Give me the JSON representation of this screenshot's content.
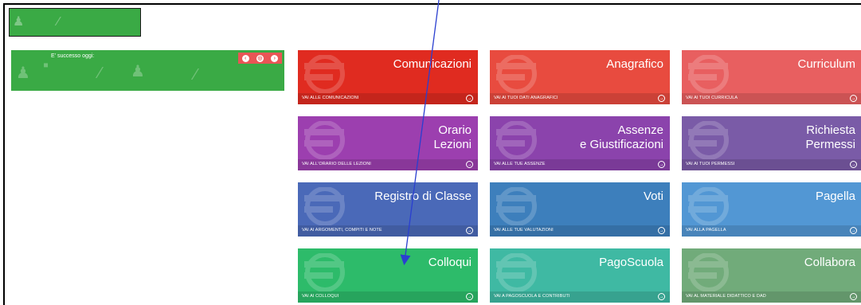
{
  "today_widget": {
    "title": "E' successo oggi:",
    "nav_icons": [
      "prev-icon",
      "settings-icon",
      "next-icon"
    ]
  },
  "tiles": [
    {
      "name": "comunicazioni",
      "title": "Comunicazioni",
      "link": "VAI ALLE COMUNICAZIONI",
      "color": "#e02b20",
      "icon": "megaphone-icon"
    },
    {
      "name": "anagrafico",
      "title": "Anagrafico",
      "link": "VAI AI TUOI DATI ANAGRAFICI",
      "color": "#e84b3f",
      "icon": "person-icon"
    },
    {
      "name": "curriculum",
      "title": "Curriculum",
      "link": "VAI AI TUOI CURRICULA",
      "color": "#e85f60",
      "icon": "list-icon"
    },
    {
      "name": "orario-lezioni",
      "title": "Orario\nLezioni",
      "link": "VAI ALL'ORARIO DELLE LEZIONI",
      "color": "#9c3faf",
      "icon": "clock-icon"
    },
    {
      "name": "assenze",
      "title": "Assenze\ne Giustificazioni",
      "link": "VAI ALLE TUE ASSENZE",
      "color": "#8b43ac",
      "icon": "stethoscope-icon"
    },
    {
      "name": "richiesta-permessi",
      "title": "Richiesta\nPermessi",
      "link": "VAI AI TUOI PERMESSI",
      "color": "#7a5ba7",
      "icon": "exit-icon"
    },
    {
      "name": "registro-classe",
      "title": "Registro di Classe",
      "link": "VAI AI ARGOMENTI, COMPITI E NOTE",
      "color": "#4a69b8",
      "icon": "book-icon"
    },
    {
      "name": "voti",
      "title": "Voti",
      "link": "VAI ALLE TUE VALUTAZIONI",
      "color": "#3d7fbc",
      "icon": "grades-icon"
    },
    {
      "name": "pagella",
      "title": "Pagella",
      "link": "VAI ALLA PAGELLA",
      "color": "#5297d4",
      "icon": "document-icon"
    },
    {
      "name": "colloqui",
      "title": "Colloqui",
      "link": "VAI AI COLLOQUI",
      "color": "#2dbb6a",
      "icon": "chat-icon"
    },
    {
      "name": "pagoscuola",
      "title": "PagoScuola",
      "link": "VAI A PAGOSCUOLA E CONTRIBUTI",
      "color": "#3fb9a3",
      "icon": "euro-icon"
    },
    {
      "name": "collabora",
      "title": "Collabora",
      "link": "VAI AL MATERIALE DIDATTICO E DAD",
      "color": "#71ab7a",
      "icon": "puzzle-icon"
    }
  ]
}
